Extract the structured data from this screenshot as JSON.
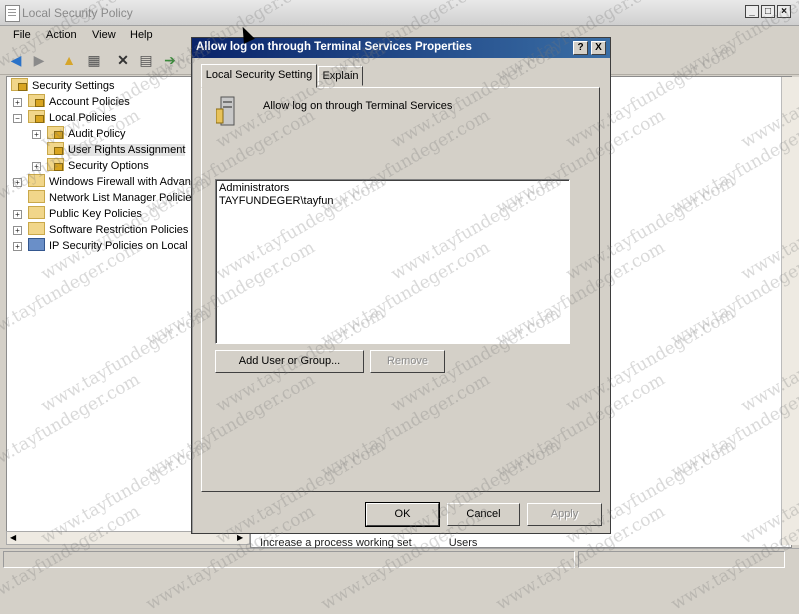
{
  "app": {
    "title": "Local Security Policy"
  },
  "menu": [
    "File",
    "Action",
    "View",
    "Help"
  ],
  "toolbar_icons": [
    "back-icon",
    "forward-icon",
    "up-icon",
    "show-hide-tree-icon",
    "delete-icon",
    "properties-icon",
    "export-icon"
  ],
  "tree": {
    "items": [
      {
        "label": "Security Settings"
      },
      {
        "label": "Account Policies"
      },
      {
        "label": "Local Policies"
      },
      {
        "label": "Audit Policy"
      },
      {
        "label": "User Rights Assignment"
      },
      {
        "label": "Security Options"
      },
      {
        "label": "Windows Firewall with Advanc"
      },
      {
        "label": "Network List Manager Policies"
      },
      {
        "label": "Public Key Policies"
      },
      {
        "label": "Software Restriction Policies"
      },
      {
        "label": "IP Security Policies on Local C"
      }
    ]
  },
  "list_peek": {
    "policy": "Increase a process working set",
    "setting": "Users"
  },
  "dialog": {
    "title": "Allow log on through Terminal Services Properties",
    "help_label": "?",
    "close_label": "X",
    "tabs": [
      "Local Security Setting",
      "Explain"
    ],
    "policy_name": "Allow log on through Terminal Services",
    "members": [
      "Administrators",
      "TAYFUNDEGER\\tayfun"
    ],
    "add_button": "Add User or Group...",
    "remove_button": "Remove",
    "ok_button": "OK",
    "cancel_button": "Cancel",
    "apply_button": "Apply"
  },
  "watermark": "www.tayfundeger.com"
}
